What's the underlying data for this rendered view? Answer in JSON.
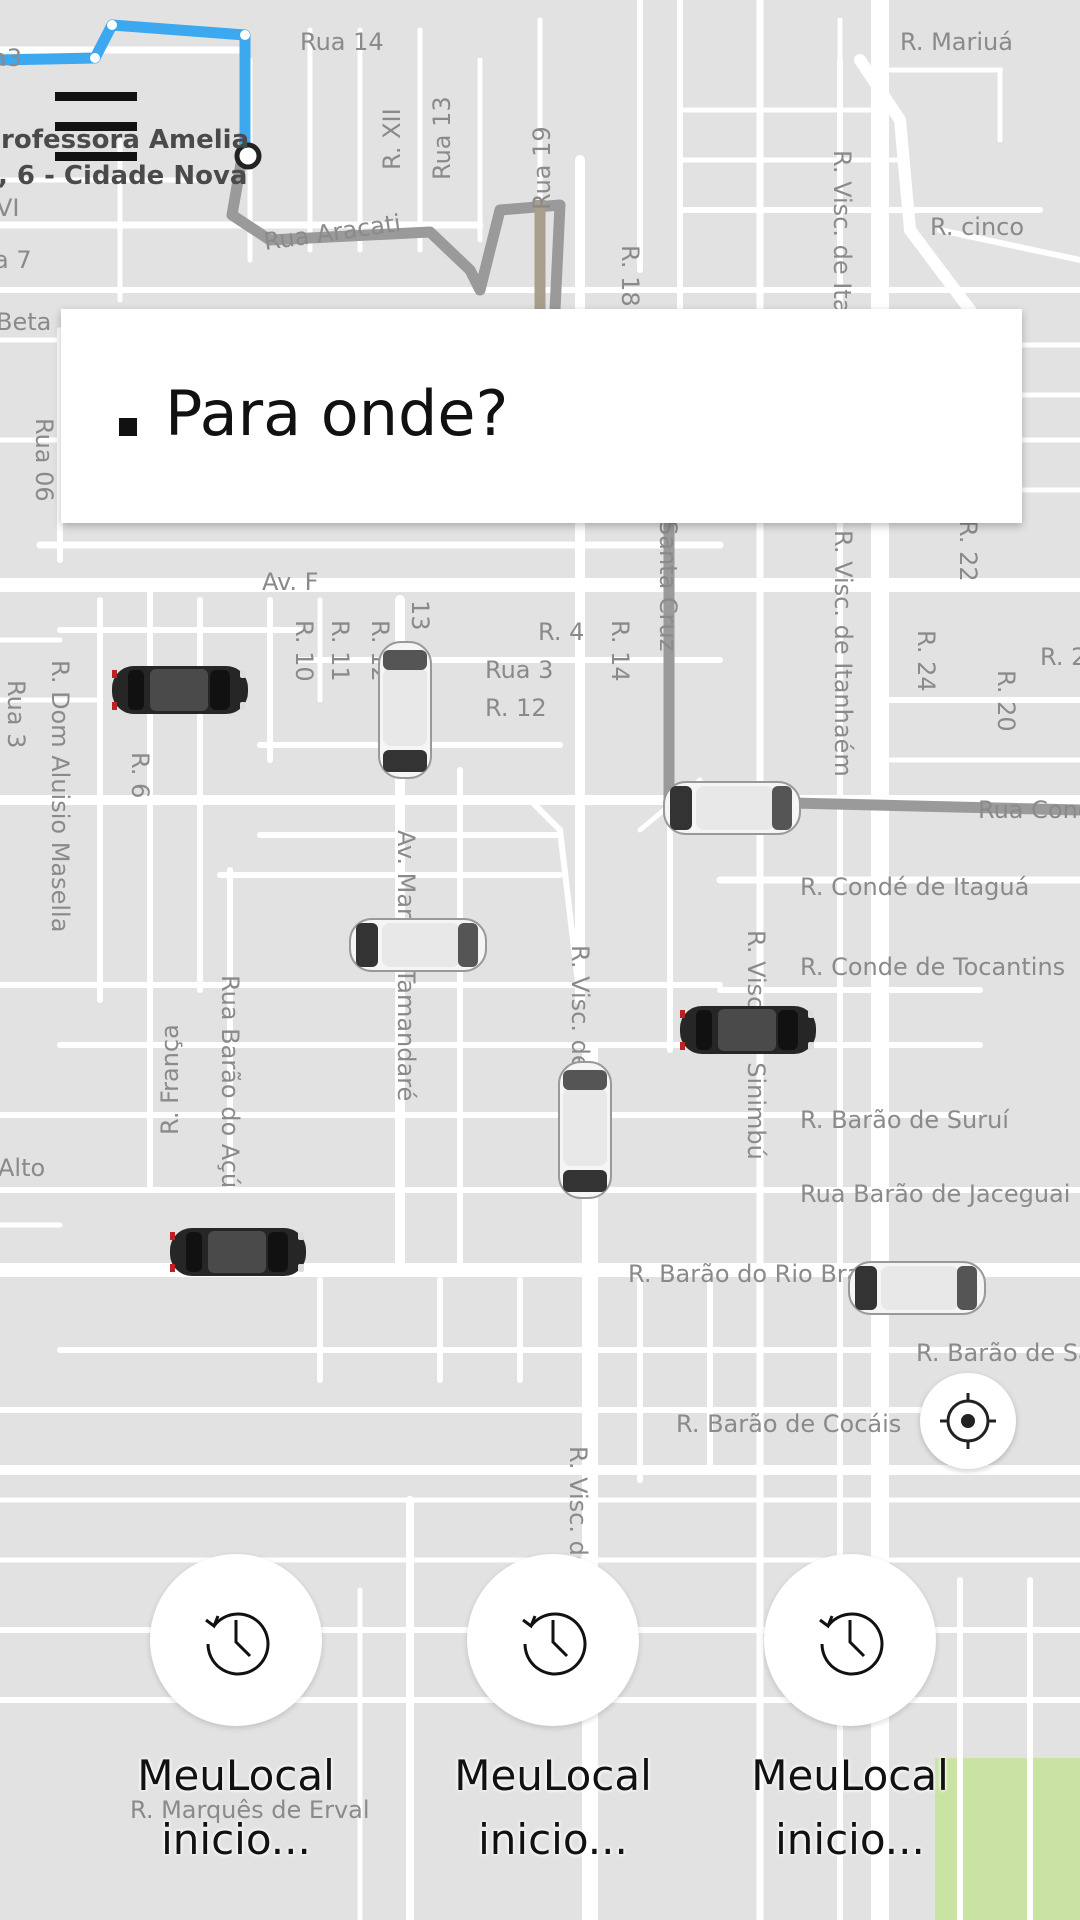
{
  "map": {
    "route_label_line1": "Professora Amelia",
    "route_label_line2": ", 6 - Cidade Nova",
    "street_labels": [
      "Rua 14",
      "R. Mariuá",
      "R. XII",
      "Rua 13",
      "Rua Aracati",
      "Rua 19",
      "R. 18",
      "R. Visc. de Ita",
      "R. cinco",
      "VI",
      "a 7",
      "Beta",
      "Rua 06",
      "Av. F",
      "R. 10",
      "R. 11",
      "R. 12",
      "13",
      "R. 4",
      "R. 14",
      "Santa Cruz",
      "R. Visc. de Itanhaém",
      "R. 22",
      "R. 24",
      "R. 20",
      "R. 2",
      "Rua 3",
      "R. 12",
      "R. Dom Aluisio Masella",
      "R. 6",
      "Rua 3",
      "Rua Cond",
      "R. Condé de Itaguá",
      "R. Conde de Tocantins",
      "Av. Mar. de Tamandaré",
      "R. Visc. de",
      "R. Visc. de Sinimbú",
      "R. França",
      "Rua Barão do Açú",
      "R. Barão de Suruí",
      "Rua Barão de Jaceguai",
      "Alto",
      "R. Barão do Rio Bra",
      "R. Barão de Sa",
      "R. Barão de Cocáis",
      "R. Visc. de",
      "R. Marquês de Erval",
      "a3"
    ]
  },
  "menu": {
    "icon": "hamburger-menu-icon"
  },
  "search": {
    "placeholder": "Para onde?"
  },
  "locate": {
    "icon": "crosshair-icon"
  },
  "shortcuts": [
    {
      "icon": "history-clock-icon",
      "label_line1": "MeuLocal",
      "label_line2": "inicio..."
    },
    {
      "icon": "history-clock-icon",
      "label_line1": "MeuLocal",
      "label_line2": "inicio..."
    },
    {
      "icon": "history-clock-icon",
      "label_line1": "MeuLocal",
      "label_line2": "inicio..."
    }
  ],
  "colors": {
    "map_background": "#e2e2e2",
    "road": "#ffffff",
    "route_blue": "#3ba8f0",
    "route_grey": "#9a9a9a",
    "park_green": "#c9e3a3"
  }
}
